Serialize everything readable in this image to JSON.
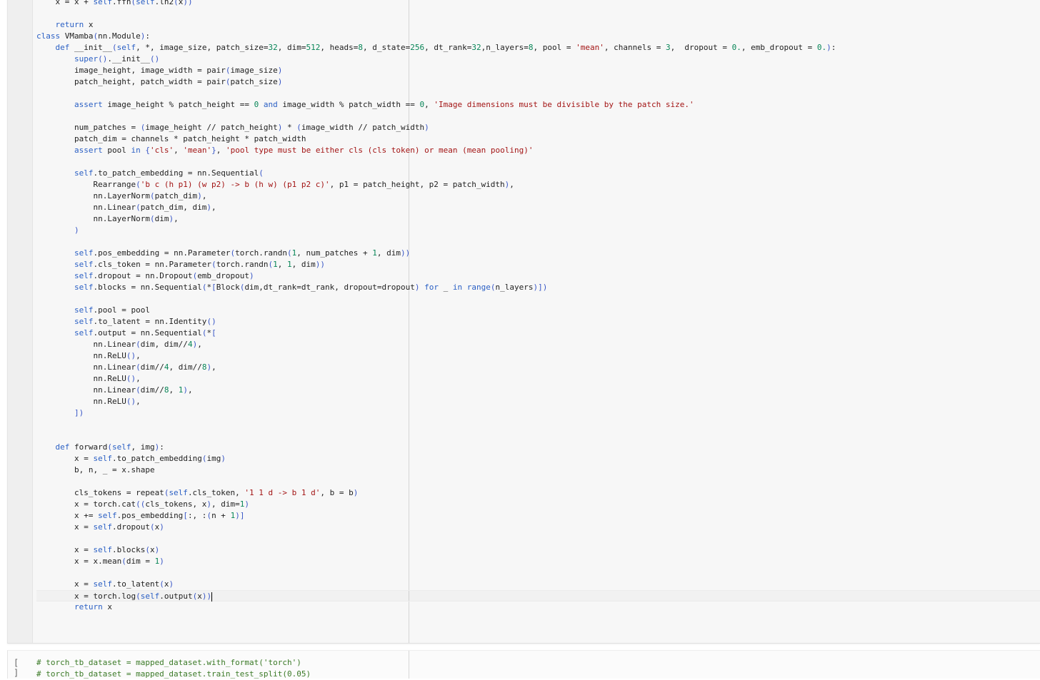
{
  "cell_main": {
    "lines": [
      "    x = x + self.ffn(self.ln2(x))",
      "",
      "    return x",
      "class VMamba(nn.Module):",
      "    def __init__(self, *, image_size, patch_size=32, dim=512, heads=8, d_state=256, dt_rank=32,n_layers=8, pool = 'mean', channels = 3,  dropout = 0., emb_dropout = 0.):",
      "        super().__init__()",
      "        image_height, image_width = pair(image_size)",
      "        patch_height, patch_width = pair(patch_size)",
      "",
      "        assert image_height % patch_height == 0 and image_width % patch_width == 0, 'Image dimensions must be divisible by the patch size.'",
      "",
      "        num_patches = (image_height // patch_height) * (image_width // patch_width)",
      "        patch_dim = channels * patch_height * patch_width",
      "        assert pool in {'cls', 'mean'}, 'pool type must be either cls (cls token) or mean (mean pooling)'",
      "",
      "        self.to_patch_embedding = nn.Sequential(",
      "            Rearrange('b c (h p1) (w p2) -> b (h w) (p1 p2 c)', p1 = patch_height, p2 = patch_width),",
      "            nn.LayerNorm(patch_dim),",
      "            nn.Linear(patch_dim, dim),",
      "            nn.LayerNorm(dim),",
      "        )",
      "",
      "        self.pos_embedding = nn.Parameter(torch.randn(1, num_patches + 1, dim))",
      "        self.cls_token = nn.Parameter(torch.randn(1, 1, dim))",
      "        self.dropout = nn.Dropout(emb_dropout)",
      "        self.blocks = nn.Sequential(*[Block(dim,dt_rank=dt_rank, dropout=dropout) for _ in range(n_layers)])",
      "",
      "        self.pool = pool",
      "        self.to_latent = nn.Identity()",
      "        self.output = nn.Sequential(*[",
      "            nn.Linear(dim, dim//4),",
      "            nn.ReLU(),",
      "            nn.Linear(dim//4, dim//8),",
      "            nn.ReLU(),",
      "            nn.Linear(dim//8, 1),",
      "            nn.ReLU(),",
      "        ])",
      "",
      "",
      "    def forward(self, img):",
      "        x = self.to_patch_embedding(img)",
      "        b, n, _ = x.shape",
      "",
      "        cls_tokens = repeat(self.cls_token, '1 1 d -> b 1 d', b = b)",
      "        x = torch.cat((cls_tokens, x), dim=1)",
      "        x += self.pos_embedding[:, :(n + 1)]",
      "        x = self.dropout(x)",
      "",
      "        x = self.blocks(x)",
      "        x = x.mean(dim = 1)",
      "",
      "        x = self.to_latent(x)",
      "        x = torch.log(self.output(x))",
      "        return x"
    ]
  },
  "cell_next": {
    "run_indicator": "[ ]",
    "lines": [
      "# torch_tb_dataset = mapped_dataset.with_format('torch')",
      "# torch_tb_dataset = mapped_dataset.train_test_split(0.05)"
    ]
  },
  "colors": {
    "keyword": "#2a5fc4",
    "string": "#a31515",
    "number": "#098658",
    "comment": "#3b7a27",
    "bracket": "#3a58c7"
  }
}
